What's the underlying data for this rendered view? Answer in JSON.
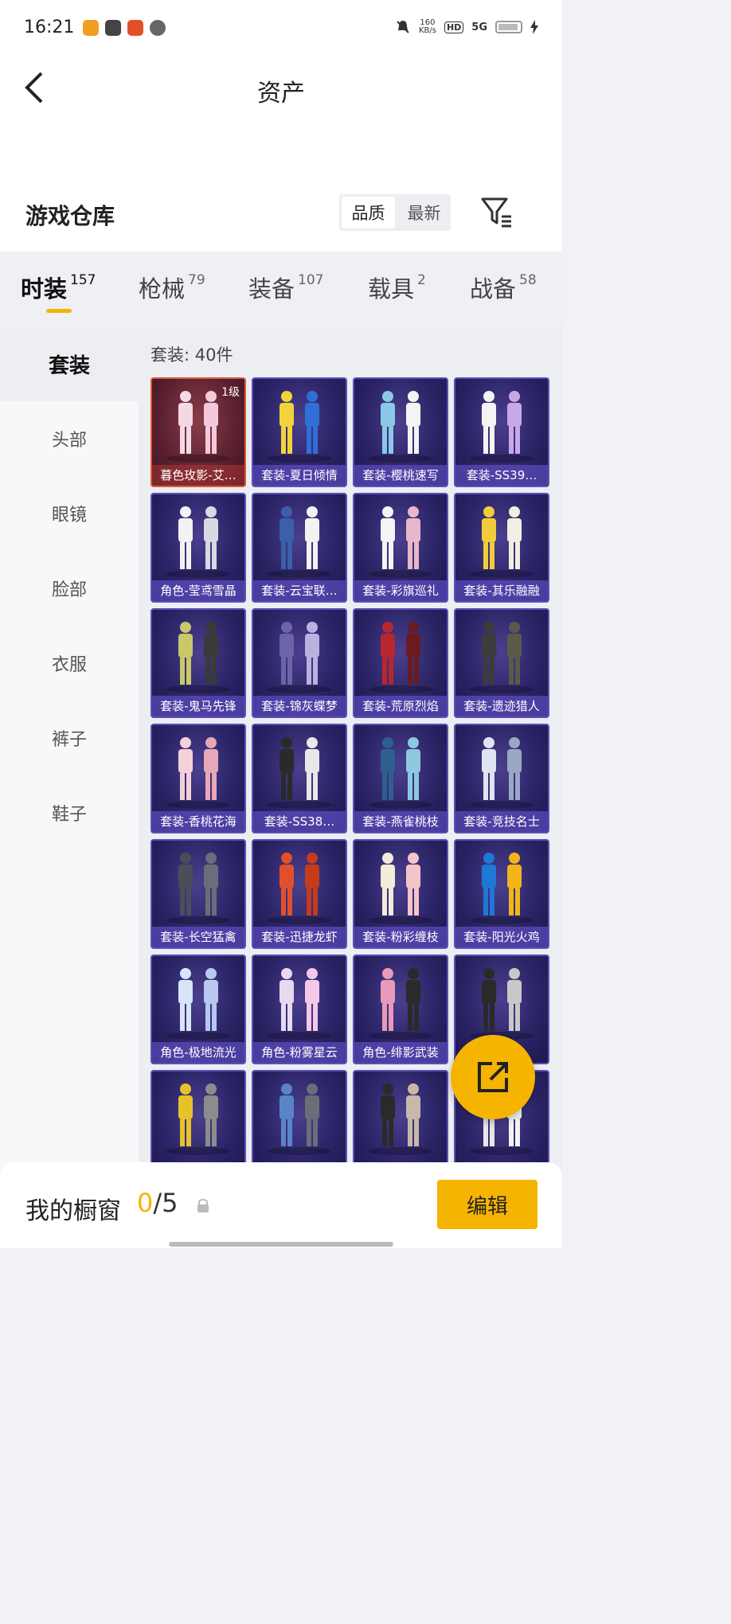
{
  "status_bar": {
    "time": "16:21",
    "speed_value": "160",
    "speed_unit": "KB/s",
    "hd": "HD",
    "network": "5G"
  },
  "header": {
    "title": "资产"
  },
  "warehouse": {
    "title": "游戏仓库",
    "sort_options": [
      "品质",
      "最新"
    ],
    "active_sort": "品质"
  },
  "tabs": [
    {
      "label": "时装",
      "count": "157",
      "active": true
    },
    {
      "label": "枪械",
      "count": "79"
    },
    {
      "label": "装备",
      "count": "107"
    },
    {
      "label": "载具",
      "count": "2"
    },
    {
      "label": "战备",
      "count": "58"
    }
  ],
  "sidenav": [
    "套装",
    "头部",
    "眼镜",
    "脸部",
    "衣服",
    "裤子",
    "鞋子"
  ],
  "sidenav_active": "套装",
  "grid": {
    "count_label": "套装: 40件",
    "items": [
      {
        "label": "暮色玫影-艾…",
        "level": "1级",
        "rare": true
      },
      {
        "label": "套装-夏日倾情"
      },
      {
        "label": "套装-樱桃速写"
      },
      {
        "label": "套装-SS39…"
      },
      {
        "label": "角色-莹鸢雪晶"
      },
      {
        "label": "套装-云宝联…"
      },
      {
        "label": "套装-彩旗巡礼"
      },
      {
        "label": "套装-其乐融融"
      },
      {
        "label": "套装-鬼马先锋"
      },
      {
        "label": "套装-锦灰蝶梦"
      },
      {
        "label": "套装-荒原烈焰"
      },
      {
        "label": "套装-遗迹猎人"
      },
      {
        "label": "套装-香桃花海"
      },
      {
        "label": "套装-SS38…"
      },
      {
        "label": "套装-燕雀桃枝"
      },
      {
        "label": "套装-竞技名士"
      },
      {
        "label": "套装-长空猛禽"
      },
      {
        "label": "套装-迅捷龙虾"
      },
      {
        "label": "套装-粉彩缠枝"
      },
      {
        "label": "套装-阳光火鸡"
      },
      {
        "label": "角色-极地流光"
      },
      {
        "label": "角色-粉雾星云"
      },
      {
        "label": "角色-绯影武装"
      },
      {
        "label": ""
      },
      {
        "label": ""
      },
      {
        "label": ""
      },
      {
        "label": ""
      },
      {
        "label": ""
      }
    ]
  },
  "bottom": {
    "showcase_label": "我的橱窗",
    "showcase_current": "0",
    "showcase_total": "/5",
    "edit_label": "编辑"
  },
  "colors": {
    "accent": "#f5b400",
    "card_border": "#5c4fb8",
    "card_rare_border": "#d95a3a"
  }
}
